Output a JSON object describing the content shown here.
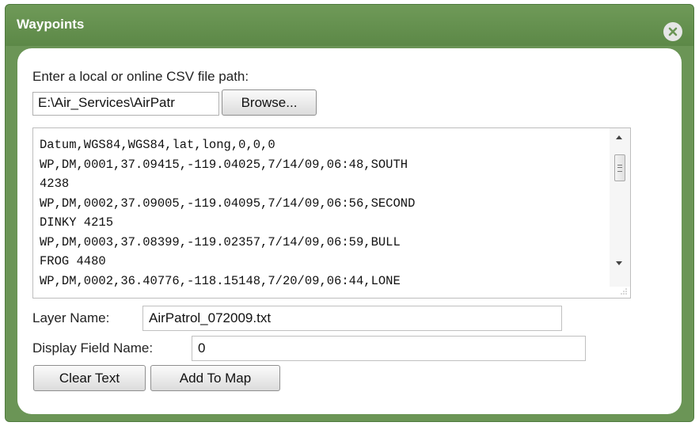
{
  "dialog": {
    "title": "Waypoints",
    "close_icon": "close-circle-icon"
  },
  "file": {
    "prompt": "Enter a local or online CSV file path:",
    "path_value": "E:\\Air_Services\\AirPatr",
    "browse_label": "Browse..."
  },
  "csv": {
    "lines": [
      "Datum,WGS84,WGS84,lat,long,0,0,0",
      "WP,DM,0001,37.09415,-119.04025,7/14/09,06:48,SOUTH",
      "4238",
      "WP,DM,0002,37.09005,-119.04095,7/14/09,06:56,SECOND",
      "DINKY 4215",
      "WP,DM,0003,37.08399,-119.02357,7/14/09,06:59,BULL",
      "FROG 4480",
      "WP,DM,0002,36.40776,-118.15148,7/20/09,06:44,LONE"
    ]
  },
  "layer": {
    "label": "Layer Name:",
    "value": "AirPatrol_072009.txt"
  },
  "display_field": {
    "label": "Display Field Name:",
    "value": "0"
  },
  "actions": {
    "clear_label": "Clear Text",
    "add_label": "Add To Map"
  },
  "colors": {
    "frame_green": "#6b9556",
    "title_text": "#ffffff"
  }
}
